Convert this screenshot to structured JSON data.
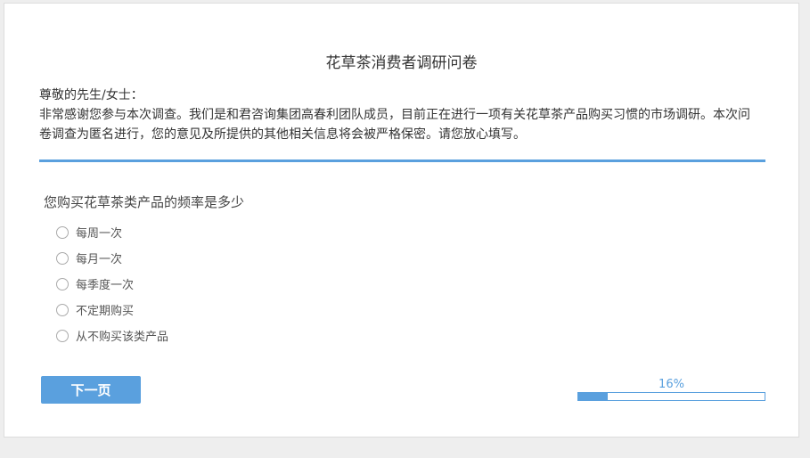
{
  "survey": {
    "title": "花草茶消费者调研问卷",
    "greeting": "尊敬的先生/女士：",
    "intro": "非常感谢您参与本次调查。我们是和君咨询集团高春利团队成员，目前正在进行一项有关花草茶产品购买习惯的市场调研。本次问卷调查为匿名进行，您的意见及所提供的其他相关信息将会被严格保密。请您放心填写。"
  },
  "question": {
    "text": "您购买花草茶类产品的频率是多少",
    "options": [
      {
        "label": "每周一次"
      },
      {
        "label": "每月一次"
      },
      {
        "label": "每季度一次"
      },
      {
        "label": "不定期购买"
      },
      {
        "label": "从不购买该类产品"
      }
    ]
  },
  "navigation": {
    "next_label": "下一页"
  },
  "progress": {
    "label": "16%",
    "percent": 16
  },
  "colors": {
    "accent": "#5aa0de",
    "background": "#eeeeee"
  }
}
